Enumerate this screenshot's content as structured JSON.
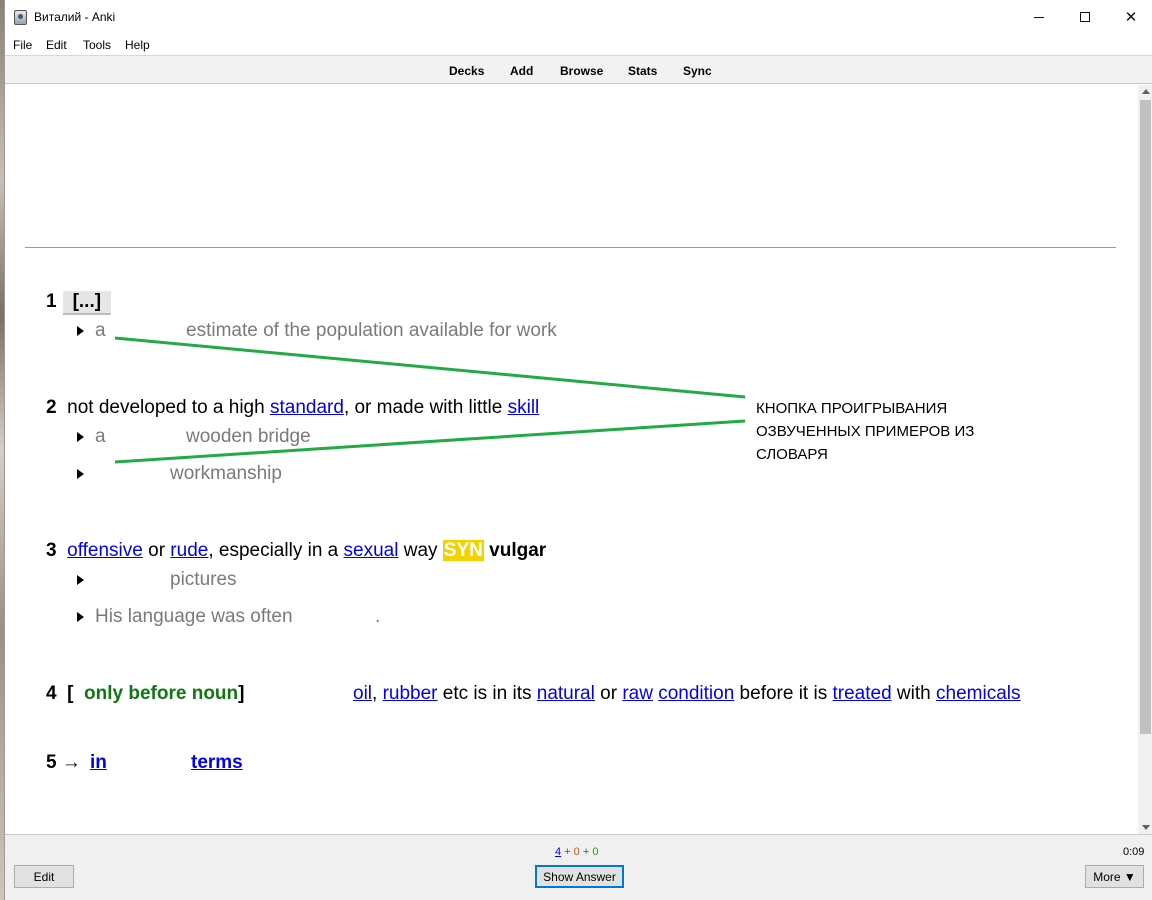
{
  "window": {
    "title": "Виталий - Anki",
    "min_icon": "minimize-icon",
    "max_icon": "maximize-icon",
    "close_icon": "close-icon"
  },
  "menu": [
    "File",
    "Edit",
    "Tools",
    "Help"
  ],
  "toolbar": [
    "Decks",
    "Add",
    "Browse",
    "Stats",
    "Sync"
  ],
  "card": {
    "def1": {
      "num": "1",
      "cloze": "[...]",
      "examples": [
        {
          "a": "a",
          "b": "estimate of the population available for work"
        }
      ]
    },
    "def2": {
      "num": "2",
      "t1": "not developed to a high ",
      "l1": "standard",
      "t2": ", or made with little ",
      "l2": "skill",
      "ex1a": "a",
      "ex1b": "wooden bridge",
      "ex2b": "workmanship"
    },
    "def3": {
      "num": "3",
      "l1": "offensive",
      "t1": " or ",
      "l2": "rude",
      "t2": ", especially in a ",
      "l3": "sexual",
      "t3": " way ",
      "syn": "SYN",
      "syn_word": "vulgar",
      "ex1b": "pictures",
      "ex2a": "His language was often",
      "ex2b": "."
    },
    "def4": {
      "num": "4",
      "open": "[",
      "grammar": "only before noun",
      "close": "]",
      "l1": "oil",
      "t1": ", ",
      "l2": "rubber",
      "t2": " etc is in its ",
      "l3": "natural",
      "t3": " or ",
      "l4": "raw",
      "t4": " ",
      "l5": "condition",
      "t5": " before it is ",
      "l6": "treated",
      "t6": " with ",
      "l7": "chemicals"
    },
    "def5": {
      "num": "5",
      "arrow": "→",
      "l1": " in",
      "l2": " terms"
    }
  },
  "annotation": {
    "lines": [
      "КНОПКА ПРОИГРЫВАНИЯ",
      "ОЗВУЧЕННЫХ ПРИМЕРОВ ИЗ",
      "СЛОВАРЯ"
    ],
    "line_color": "#22aa44"
  },
  "bottom": {
    "new": "4",
    "plus1": " + ",
    "learn": "0",
    "plus2": " + ",
    "review": "0",
    "timer": "0:09",
    "edit": "Edit",
    "show_answer": "Show Answer",
    "more": "More ▼"
  },
  "play_icon": "play-triangle-icon"
}
